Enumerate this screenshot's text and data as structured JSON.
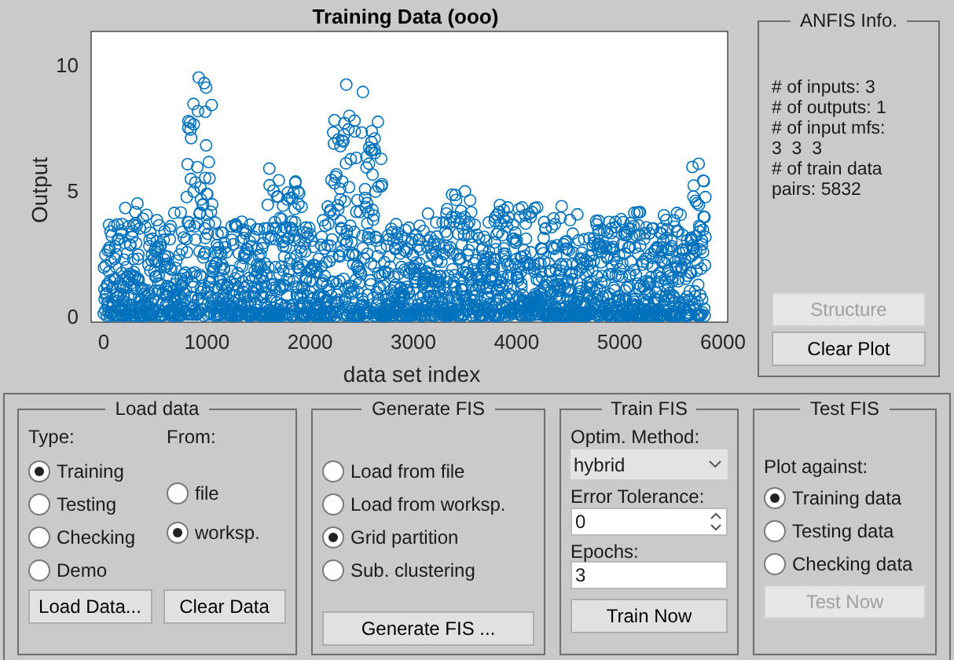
{
  "plot": {
    "title": "Training Data (ooo)",
    "xlabel": "data set index",
    "ylabel": "Output",
    "xticks": [
      "0",
      "1000",
      "2000",
      "3000",
      "4000",
      "5000",
      "6000"
    ],
    "yticks": [
      "10",
      "5",
      "0"
    ]
  },
  "anfis_info": {
    "title": "ANFIS Info.",
    "lines": [
      "# of inputs: 3",
      "# of outputs: 1",
      "# of input mfs:",
      "3  3  3",
      "# of train data",
      "pairs: 5832"
    ],
    "buttons": [
      {
        "label": "Structure",
        "disabled": true
      },
      {
        "label": "Clear Plot",
        "disabled": false
      }
    ]
  },
  "load_data": {
    "title": "Load data",
    "type_label": "Type:",
    "from_label": "From:",
    "type_options": [
      {
        "label": "Training",
        "selected": true
      },
      {
        "label": "Testing",
        "selected": false
      },
      {
        "label": "Checking",
        "selected": false
      },
      {
        "label": "Demo",
        "selected": false
      }
    ],
    "from_options": [
      {
        "label": "file",
        "selected": false
      },
      {
        "label": "worksp.",
        "selected": true
      }
    ],
    "buttons": [
      {
        "label": "Load Data...",
        "disabled": false
      },
      {
        "label": "Clear Data",
        "disabled": false
      }
    ]
  },
  "generate_fis": {
    "title": "Generate FIS",
    "options": [
      {
        "label": "Load from file",
        "selected": false
      },
      {
        "label": "Load from worksp.",
        "selected": false
      },
      {
        "label": "Grid partition",
        "selected": true
      },
      {
        "label": "Sub. clustering",
        "selected": false
      }
    ],
    "button": {
      "label": "Generate FIS ...",
      "disabled": false
    }
  },
  "train_fis": {
    "title": "Train FIS",
    "method_label": "Optim. Method:",
    "method_value": "hybrid",
    "tolerance_label": "Error Tolerance:",
    "tolerance_value": "0",
    "epochs_label": "Epochs:",
    "epochs_value": "3",
    "button": {
      "label": "Train Now",
      "disabled": false
    }
  },
  "test_fis": {
    "title": "Test FIS",
    "plot_against_label": "Plot against:",
    "options": [
      {
        "label": "Training data",
        "selected": true
      },
      {
        "label": "Testing data",
        "selected": false
      },
      {
        "label": "Checking data",
        "selected": false
      }
    ],
    "button": {
      "label": "Test Now",
      "disabled": true
    }
  }
}
